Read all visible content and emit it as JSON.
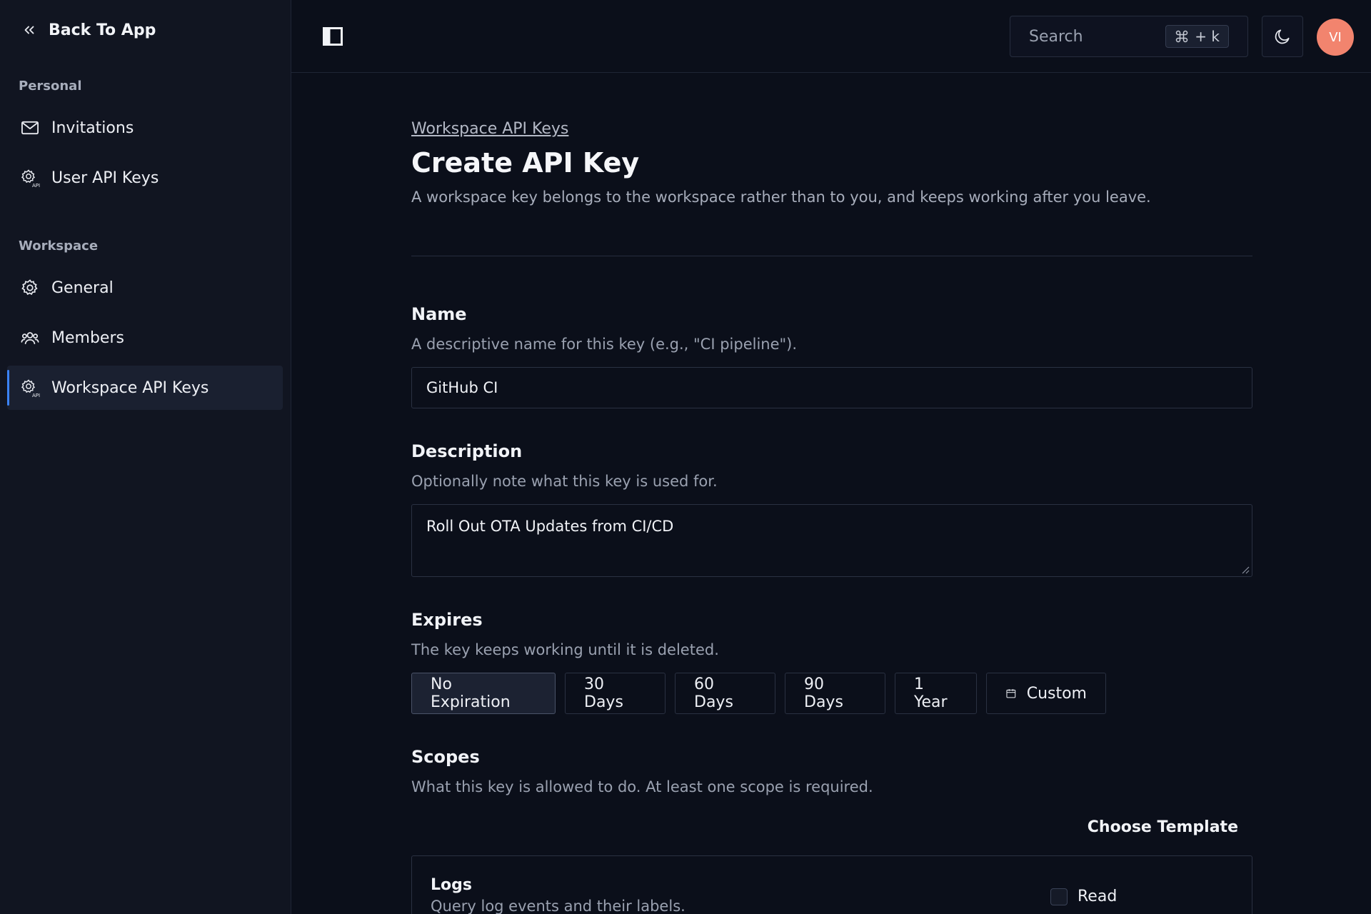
{
  "sidebar": {
    "back_label": "Back To App",
    "personal_label": "Personal",
    "workspace_label": "Workspace",
    "personal_items": [
      {
        "label": "Invitations",
        "icon": "mail-icon"
      },
      {
        "label": "User API Keys",
        "icon": "gear-api-icon"
      }
    ],
    "workspace_items": [
      {
        "label": "General",
        "icon": "gear-icon"
      },
      {
        "label": "Members",
        "icon": "users-icon"
      },
      {
        "label": "Workspace API Keys",
        "icon": "gear-api-icon",
        "active": true
      }
    ]
  },
  "topbar": {
    "search_placeholder": "Search",
    "shortcut_key": "+ k",
    "avatar_initials": "VI",
    "avatar_color": "#f2846e"
  },
  "page": {
    "breadcrumb": "Workspace API Keys",
    "title": "Create API Key",
    "subtitle": "A workspace key belongs to the workspace rather than to you, and keeps working after you leave."
  },
  "form": {
    "name": {
      "label": "Name",
      "help": "A descriptive name for this key (e.g., \"CI pipeline\").",
      "value": "GitHub CI"
    },
    "description": {
      "label": "Description",
      "help": "Optionally note what this key is used for.",
      "value": "Roll Out OTA Updates from CI/CD"
    },
    "expires": {
      "label": "Expires",
      "help": "The key keeps working until it is deleted.",
      "options": [
        "No Expiration",
        "30 Days",
        "60 Days",
        "90 Days",
        "1 Year",
        "Custom"
      ],
      "selected": "No Expiration"
    },
    "scopes": {
      "label": "Scopes",
      "help": "What this key is allowed to do. At least one scope is required.",
      "template_label": "Choose Template",
      "items": [
        {
          "name": "Logs",
          "description": "Query log events and their labels.",
          "permission": "Read",
          "checked": false
        }
      ]
    }
  },
  "colors": {
    "accent": "#3b82f6",
    "background": "#0b0f1a",
    "sidebar": "#111521"
  }
}
